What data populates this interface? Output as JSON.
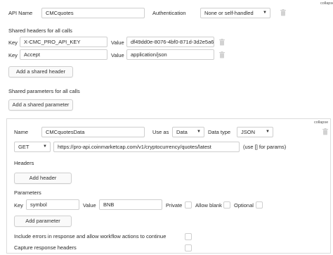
{
  "top_right_label": "collapse",
  "api": {
    "name_label": "API Name",
    "name_value": "CMCquotes",
    "auth_label": "Authentication",
    "auth_value": "None or self-handled"
  },
  "shared_headers": {
    "title": "Shared headers for all calls",
    "rows": [
      {
        "key_label": "Key",
        "key": "X-CMC_PRO_API_KEY",
        "value_label": "Value",
        "value": "df49dd0e-8076-4bf0-871d-3d2e5a6"
      },
      {
        "key_label": "Key",
        "key": "Accept",
        "value_label": "Value",
        "value": "application/json"
      }
    ],
    "add_button": "Add a shared header"
  },
  "shared_params": {
    "title": "Shared parameters for all calls",
    "add_button": "Add a shared parameter"
  },
  "call": {
    "collapse_label": "collapse",
    "name_label": "Name",
    "name_value": "CMCquotesData",
    "use_as_label": "Use as",
    "use_as_value": "Data",
    "data_type_label": "Data type",
    "data_type_value": "JSON",
    "method": "GET",
    "url": "https://pro-api.coinmarketcap.com/v1/cryptocurrency/quotes/latest",
    "url_hint": "(use [] for params)",
    "headers_title": "Headers",
    "add_header_button": "Add header",
    "params_title": "Parameters",
    "param": {
      "key_label": "Key",
      "key": "symbol",
      "value_label": "Value",
      "value": "BNB",
      "private_label": "Private",
      "allow_blank_label": "Allow blank",
      "optional_label": "Optional"
    },
    "add_param_button": "Add parameter",
    "include_errors_label": "Include errors in response and allow workflow actions to continue",
    "capture_headers_label": "Capture response headers"
  }
}
